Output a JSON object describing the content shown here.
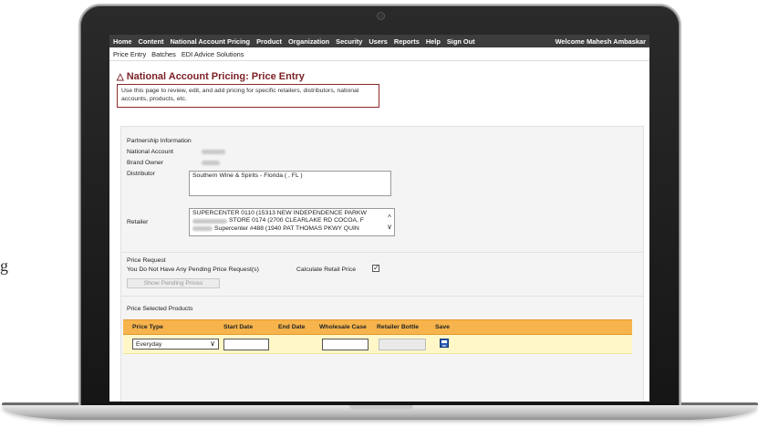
{
  "edge_text": "g",
  "topnav": {
    "items": [
      "Home",
      "Content",
      "National Account Pricing",
      "Product",
      "Organization",
      "Security",
      "Users",
      "Reports",
      "Help",
      "Sign Out"
    ],
    "welcome": "Welcome Mahesh Ambaskar"
  },
  "subnav": {
    "items": [
      "Price Entry",
      "Batches",
      "EDI Advice Solutions"
    ]
  },
  "page": {
    "title": "National Account Pricing: Price Entry",
    "description": "Use this page to review, edit, and add pricing for specific retailers, distributors, national accounts, products, etc."
  },
  "partnership": {
    "heading": "Partnership Information",
    "national_account_label": "National Account",
    "brand_owner_label": "Brand Owner",
    "distributor_label": "Distributor",
    "distributor_value": "Southern Wine & Spirits - Florida ( , FL )",
    "retailer_label": "Retailer",
    "retailers": [
      "SUPERCENTER 0110 (15313 NEW INDEPENDENCE PARKW",
      "STORE 0174 (2700 CLEARLAKE RD COCOA, F",
      "Supercenter #488 (1940 PAT THOMAS PKWY QUIN"
    ]
  },
  "price_request": {
    "heading": "Price Request",
    "pending_text": "You Do Not Have Any Pending Price Request(s)",
    "calculate_label": "Calculate Retail Price",
    "calculate_checked": true,
    "show_pending_label": "Show Pending Prices"
  },
  "price_selected": {
    "heading": "Price Selected Products",
    "columns": [
      "Price Type",
      "Start Date",
      "End Date",
      "Wholesale Case",
      "Retailer Bottle",
      "Save"
    ],
    "row": {
      "price_type": "Everyday"
    }
  },
  "colors": {
    "nav_bg": "#3d3d3d",
    "title": "#7b1f24",
    "grid_header": "#f7b44c",
    "grid_row": "#fff7c8"
  }
}
